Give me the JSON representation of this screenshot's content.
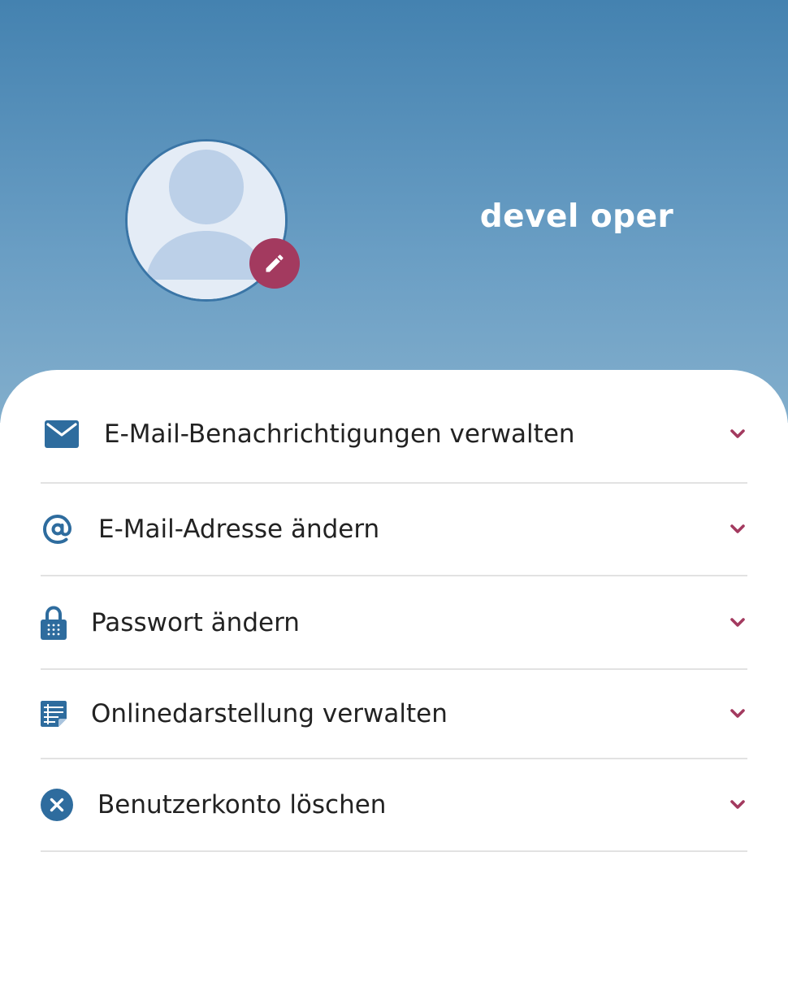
{
  "profile": {
    "name": "devel oper",
    "avatar_icon": "user-silhouette-icon",
    "edit_icon": "pencil-icon"
  },
  "colors": {
    "header_top": "#4482b0",
    "header_bottom": "#82aecc",
    "icon_blue": "#2e6c9e",
    "accent": "#a33a5f"
  },
  "settings": {
    "items": [
      {
        "label": "E-Mail-Benachrichtigungen verwalten",
        "icon": "envelope-icon"
      },
      {
        "label": "E-Mail-Adresse ändern",
        "icon": "at-sign-icon"
      },
      {
        "label": "Passwort ändern",
        "icon": "lock-icon"
      },
      {
        "label": "Onlinedarstellung verwalten",
        "icon": "document-list-icon"
      },
      {
        "label": "Benutzerkonto löschen",
        "icon": "close-circle-icon"
      }
    ]
  }
}
